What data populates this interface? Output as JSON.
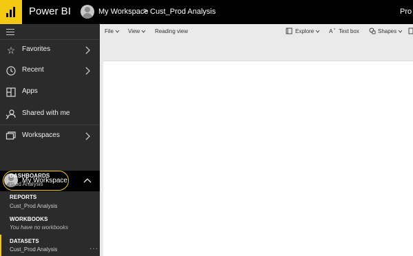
{
  "app": {
    "title": "Power BI",
    "brand_color": "#f2c811"
  },
  "breadcrumb": {
    "workspace": "My Workspace",
    "separator": ">",
    "report": "Cust_Prod Analysis",
    "right_label": "Pro"
  },
  "sidebar": {
    "items": [
      {
        "label": "Favorites",
        "icon": "star-icon"
      },
      {
        "label": "Recent",
        "icon": "clock-icon"
      },
      {
        "label": "Apps",
        "icon": "apps-icon"
      },
      {
        "label": "Shared with me",
        "icon": "shared-icon"
      },
      {
        "label": "Workspaces",
        "icon": "workspaces-icon"
      }
    ],
    "my_workspace": {
      "label": "My Workspace"
    },
    "sections": {
      "dashboards": {
        "header": "DASHBOARDS",
        "item": "Prod Analysis"
      },
      "reports": {
        "header": "REPORTS",
        "item": "Cust_Prod Analysis"
      },
      "workbooks": {
        "header": "WORKBOOKS",
        "item": "You have no workbooks"
      },
      "datasets": {
        "header": "DATASETS",
        "item": "Cust_Prod Analysis",
        "more": "···"
      }
    }
  },
  "toolbar": {
    "file": "File",
    "view": "View",
    "reading_view": "Reading view",
    "explore": "Explore",
    "text_box": "Text box",
    "shapes": "Shapes"
  }
}
